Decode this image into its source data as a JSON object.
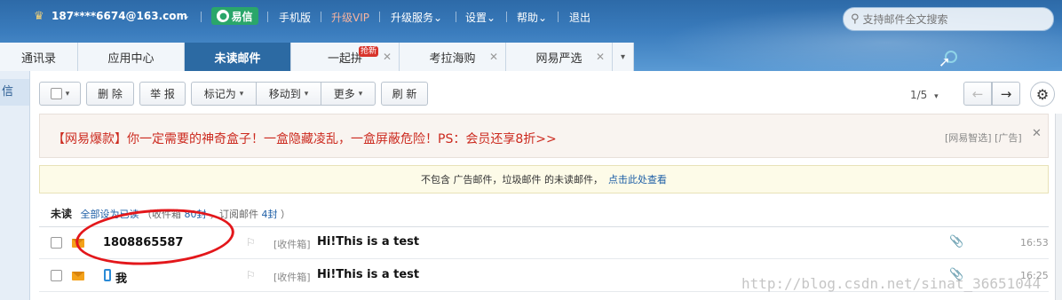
{
  "top": {
    "account": "187****6674@163.com",
    "yixin": "易信",
    "mobile": "手机版",
    "vip": "升级VIP",
    "upgrade": "升级服务",
    "settings": "设置",
    "help": "帮助",
    "logout": "退出",
    "search_placeholder": "支持邮件全文搜索"
  },
  "tabs": [
    {
      "label": "通讯录"
    },
    {
      "label": "应用中心"
    },
    {
      "label": "未读邮件"
    },
    {
      "label": "一起拼",
      "badge": "抢新"
    },
    {
      "label": "考拉海购"
    },
    {
      "label": "网易严选"
    }
  ],
  "leftstrip": {
    "label": "信"
  },
  "toolbar": {
    "delete": "删 除",
    "report": "举 报",
    "mark": "标记为",
    "move": "移动到",
    "more": "更多",
    "refresh": "刷 新",
    "pager": "1/5"
  },
  "ad": {
    "text": "【网易爆款】你一定需要的神奇盒子！一盒隐藏凌乱，一盒屏蔽危险！PS：会员还享8折>>",
    "label": "[网易智选] [广告]"
  },
  "notice": {
    "text": "不包含 广告邮件，垃圾邮件 的未读邮件，",
    "link": "点击此处查看"
  },
  "summary": {
    "title": "未读",
    "mark_all": "全部设为已读",
    "inbox_prefix": "（收件箱",
    "inbox_count": "80封",
    "sub_prefix": "，订阅邮件",
    "sub_count": "4封",
    "suffix": "）"
  },
  "rows": [
    {
      "sender": "1808865587",
      "folder": "[收件箱]",
      "subject": "Hi!This is a test",
      "time": "16:53"
    },
    {
      "sender": "我",
      "folder": "[收件箱]",
      "subject": "Hi!This is a test",
      "time": "16:25"
    }
  ],
  "watermark": "http://blog.csdn.net/sinat_36651044"
}
